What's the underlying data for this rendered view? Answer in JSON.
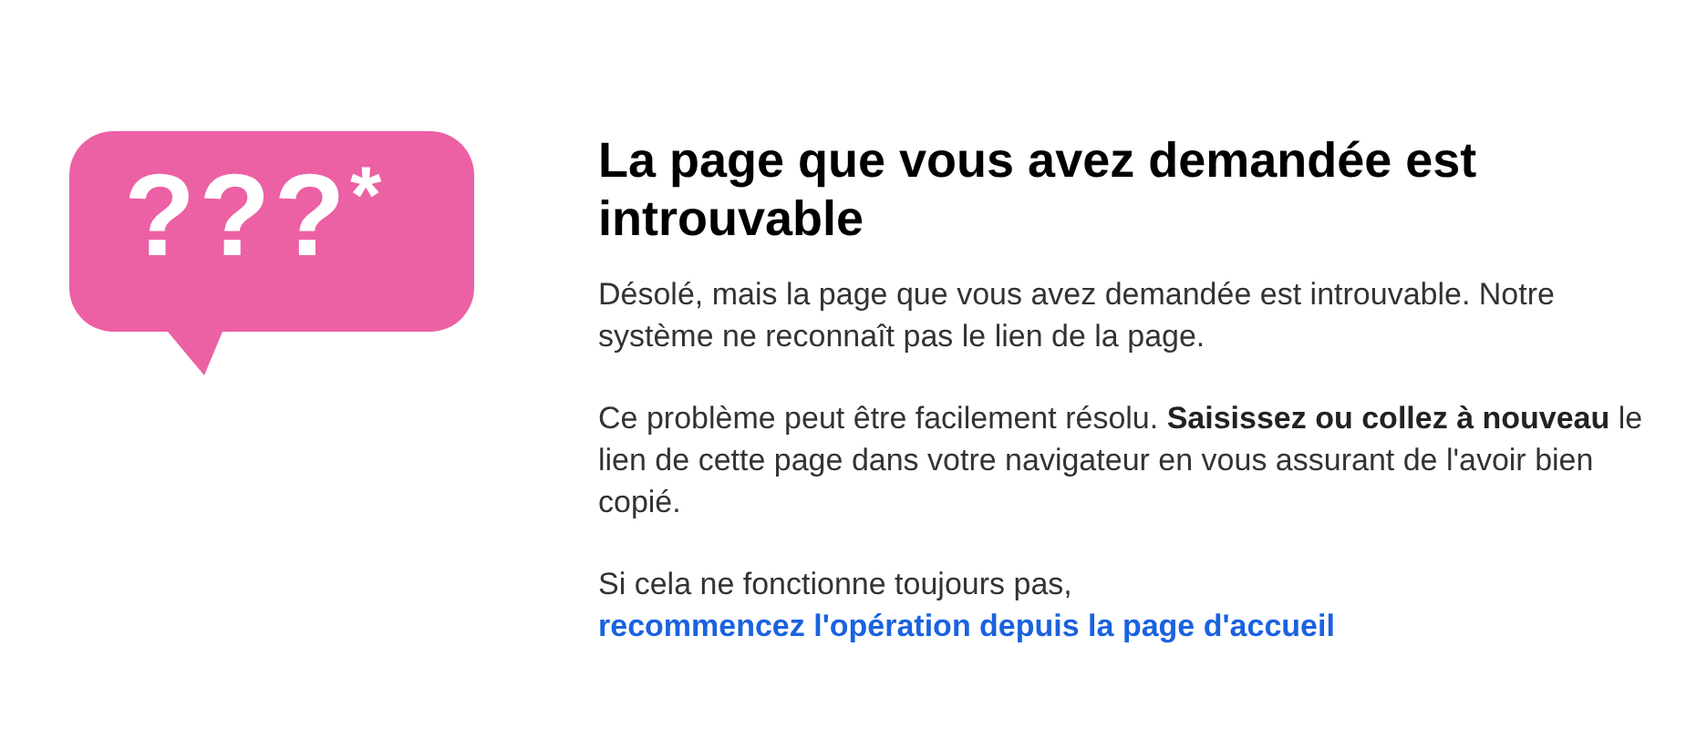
{
  "badge": {
    "marks": "???",
    "asterisk": "*"
  },
  "title": "La page que vous avez demandée est introuvable",
  "paragraphs": [
    {
      "text": "Désolé, mais la page que vous avez demandée est introuvable. Notre système ne reconnaît pas le lien de la page."
    },
    {
      "text": "Ce problème peut être facilement résolu. **Saisissez ou collez à nouveau** le lien de cette page dans votre navigateur en vous assurant de l'avoir bien copié."
    },
    {
      "text": "Si cela ne fonctionne toujours pas,",
      "link": "recommencez l'opération depuis la page d'accueil"
    }
  ]
}
